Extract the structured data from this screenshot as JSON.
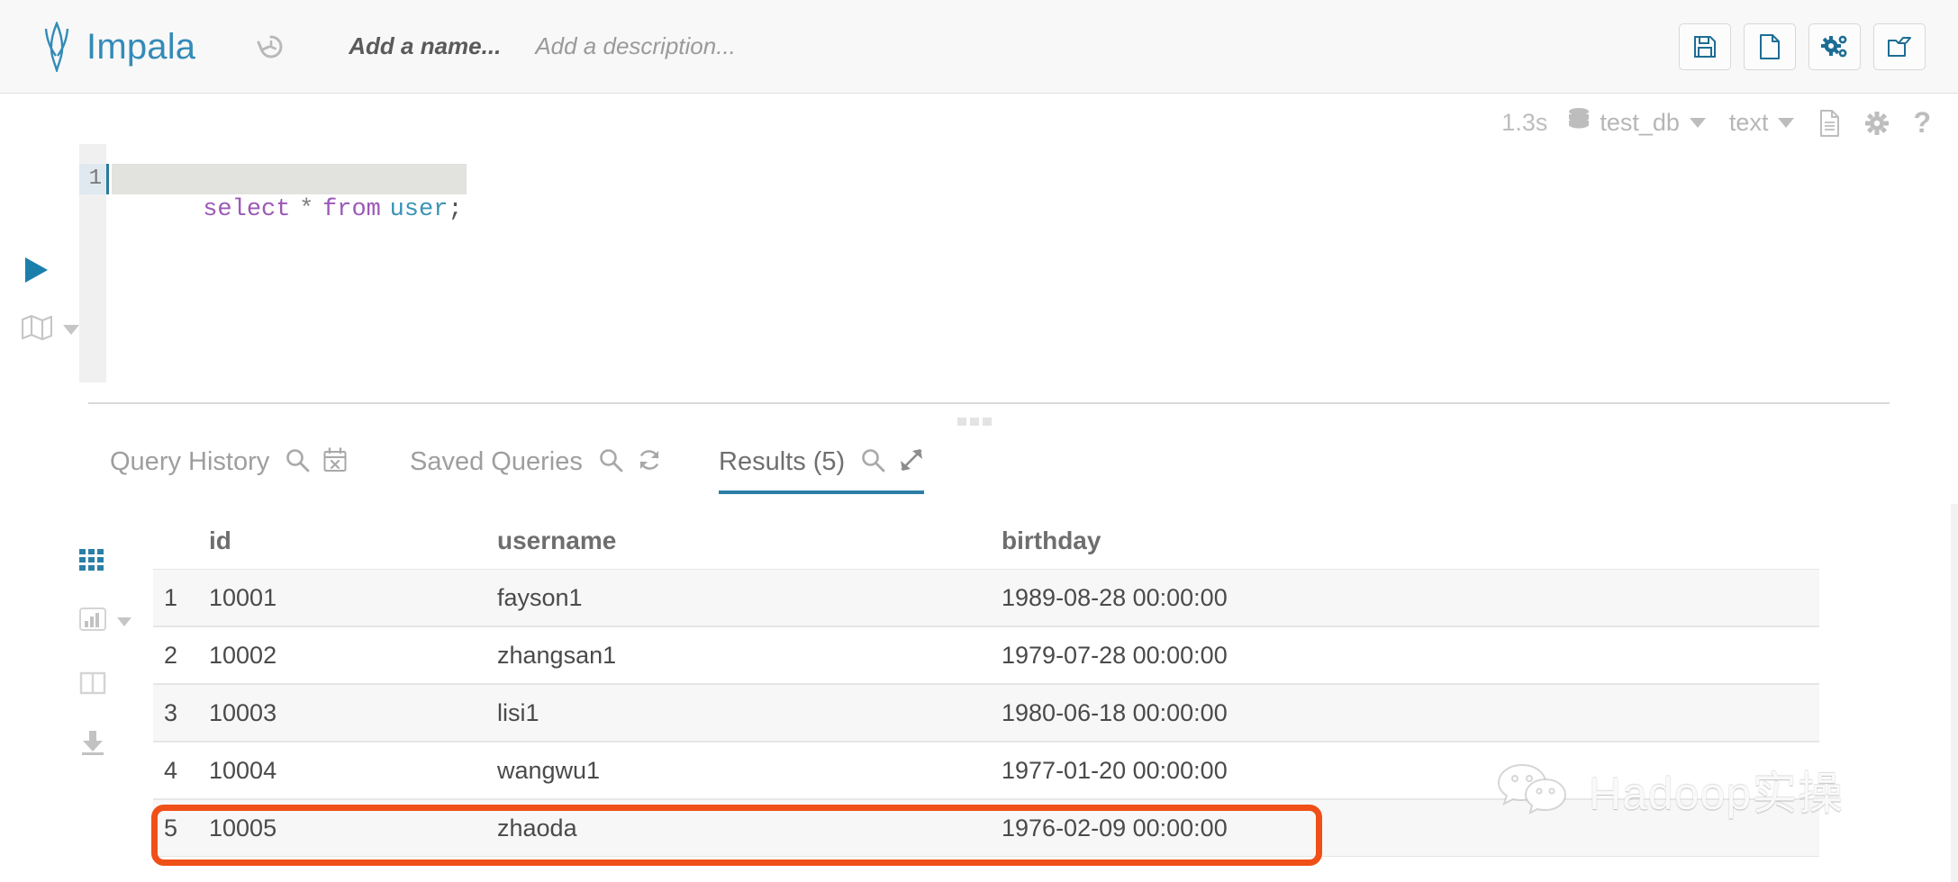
{
  "header": {
    "app_title": "Impala",
    "logo_icon": "impala-logo-icon",
    "history_icon": "history-revert-icon",
    "name_placeholder": "Add a name...",
    "description_placeholder": "Add a description...",
    "brand_color": "#338bb8",
    "actions": [
      {
        "name": "save-button",
        "icon": "floppy-save-icon",
        "title": "Save"
      },
      {
        "name": "new-query-button",
        "icon": "new-document-icon",
        "title": "New"
      },
      {
        "name": "settings-button",
        "icon": "gears-icon",
        "title": "Settings"
      },
      {
        "name": "open-button",
        "icon": "open-folder-icon",
        "title": "Open"
      }
    ]
  },
  "meta_bar": {
    "execution_time": "1.3s",
    "database_icon": "database-icon",
    "database": "test_db",
    "format": "text",
    "doc_icon": "document-icon",
    "gear_icon": "gear-icon",
    "help_icon": "question-mark-icon"
  },
  "editor": {
    "run_icon": "play-run-icon",
    "map_icon": "map-icon",
    "line_number": "1",
    "code_tokens": [
      {
        "text": "select",
        "type": "keyword"
      },
      {
        "text": " ",
        "type": "plain"
      },
      {
        "text": "*",
        "type": "operator"
      },
      {
        "text": " ",
        "type": "plain"
      },
      {
        "text": "from",
        "type": "keyword"
      },
      {
        "text": " ",
        "type": "plain"
      },
      {
        "text": "user",
        "type": "table"
      },
      {
        "text": ";",
        "type": "punct"
      }
    ],
    "code_plain": "select * from user;"
  },
  "tabs": [
    {
      "name": "tab-query-history",
      "label": "Query History",
      "active": false,
      "icons": [
        "search-icon",
        "calendar-clear-icon"
      ]
    },
    {
      "name": "tab-saved-queries",
      "label": "Saved Queries",
      "active": false,
      "icons": [
        "search-icon",
        "refresh-icon"
      ]
    },
    {
      "name": "tab-results",
      "label": "Results (5)",
      "active": true,
      "icons": [
        "search-icon",
        "expand-icon"
      ]
    }
  ],
  "results_sidebar": [
    {
      "name": "grid-view-icon",
      "label": "grid-view-icon",
      "active": true
    },
    {
      "name": "chart-view-icon",
      "label": "bar-chart-icon",
      "active": false
    },
    {
      "name": "columns-view-icon",
      "label": "columns-icon",
      "active": false
    },
    {
      "name": "download-icon",
      "label": "download-icon",
      "active": false
    }
  ],
  "results_table": {
    "columns": [
      "id",
      "username",
      "birthday"
    ],
    "rows": [
      {
        "n": "1",
        "id": "10001",
        "username": "fayson1",
        "birthday": "1989-08-28 00:00:00"
      },
      {
        "n": "2",
        "id": "10002",
        "username": "zhangsan1",
        "birthday": "1979-07-28 00:00:00"
      },
      {
        "n": "3",
        "id": "10003",
        "username": "lisi1",
        "birthday": "1980-06-18 00:00:00"
      },
      {
        "n": "4",
        "id": "10004",
        "username": "wangwu1",
        "birthday": "1977-01-20 00:00:00"
      },
      {
        "n": "5",
        "id": "10005",
        "username": "zhaoda",
        "birthday": "1976-02-09 00:00:00"
      }
    ],
    "highlighted_row_index": 4,
    "highlight_color": "#f04f18"
  },
  "watermark": {
    "icon": "wechat-icon",
    "text": "Hadoop实操"
  }
}
